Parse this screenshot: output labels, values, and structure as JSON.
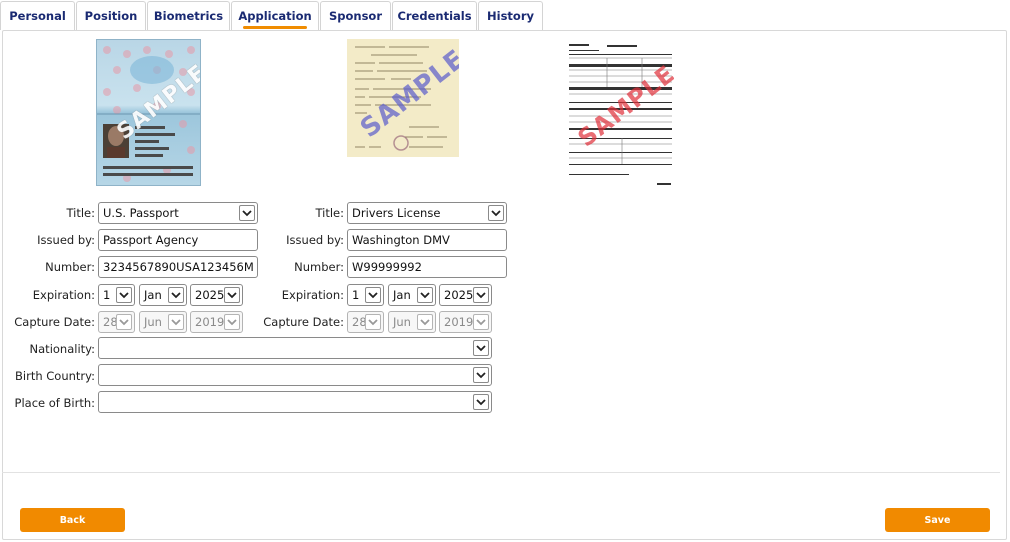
{
  "tabs": [
    {
      "label": "Personal"
    },
    {
      "label": "Position"
    },
    {
      "label": "Biometrics"
    },
    {
      "label": "Application",
      "active": true
    },
    {
      "label": "Sponsor"
    },
    {
      "label": "Credentials"
    },
    {
      "label": "History"
    }
  ],
  "watermark": "SAMPLE",
  "left_doc": {
    "title_label": "Title:",
    "title_value": "U.S. Passport",
    "issued_label": "Issued by:",
    "issued_value": "Passport Agency",
    "number_label": "Number:",
    "number_value": "3234567890USA123456M",
    "expiration_label": "Expiration:",
    "exp_day": "1",
    "exp_month": "Jan",
    "exp_year": "2025",
    "capture_label": "Capture Date:",
    "cap_day": "28",
    "cap_month": "Jun",
    "cap_year": "2019"
  },
  "right_doc": {
    "title_label": "Title:",
    "title_value": "Drivers License",
    "issued_label": "Issued by:",
    "issued_value": "Washington DMV",
    "number_label": "Number:",
    "number_value": "W99999992",
    "expiration_label": "Expiration:",
    "exp_day": "1",
    "exp_month": "Jan",
    "exp_year": "2025",
    "capture_label": "Capture Date:",
    "cap_day": "28",
    "cap_month": "Jun",
    "cap_year": "2019"
  },
  "nationality_label": "Nationality:",
  "nationality_value": "",
  "birth_country_label": "Birth Country:",
  "birth_country_value": "",
  "place_of_birth_label": "Place of Birth:",
  "place_of_birth_value": "",
  "buttons": {
    "back": "Back",
    "save": "Save"
  },
  "colors": {
    "accent": "#f18a00",
    "tab_text": "#1a2a72",
    "watermark_blue": "#5a5ccc",
    "watermark_red": "#e0303a"
  }
}
